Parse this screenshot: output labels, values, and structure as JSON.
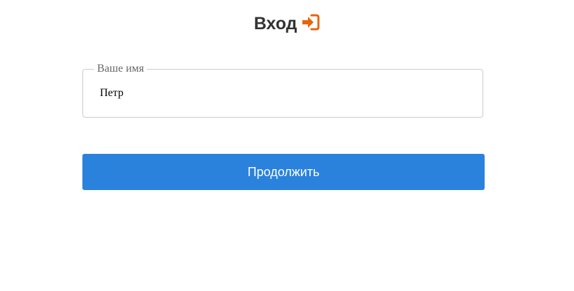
{
  "header": {
    "title": "Вход",
    "title_icon": "sign-in-icon"
  },
  "form": {
    "name_field": {
      "label": "Ваше имя",
      "value": "Петр"
    },
    "continue_label": "Продолжить"
  },
  "colors": {
    "title": "#333333",
    "icon": "#e8640c",
    "button_bg": "#2a82dd",
    "button_text": "#ffffff",
    "field_border": "#cccccc",
    "label_text": "#666666"
  }
}
